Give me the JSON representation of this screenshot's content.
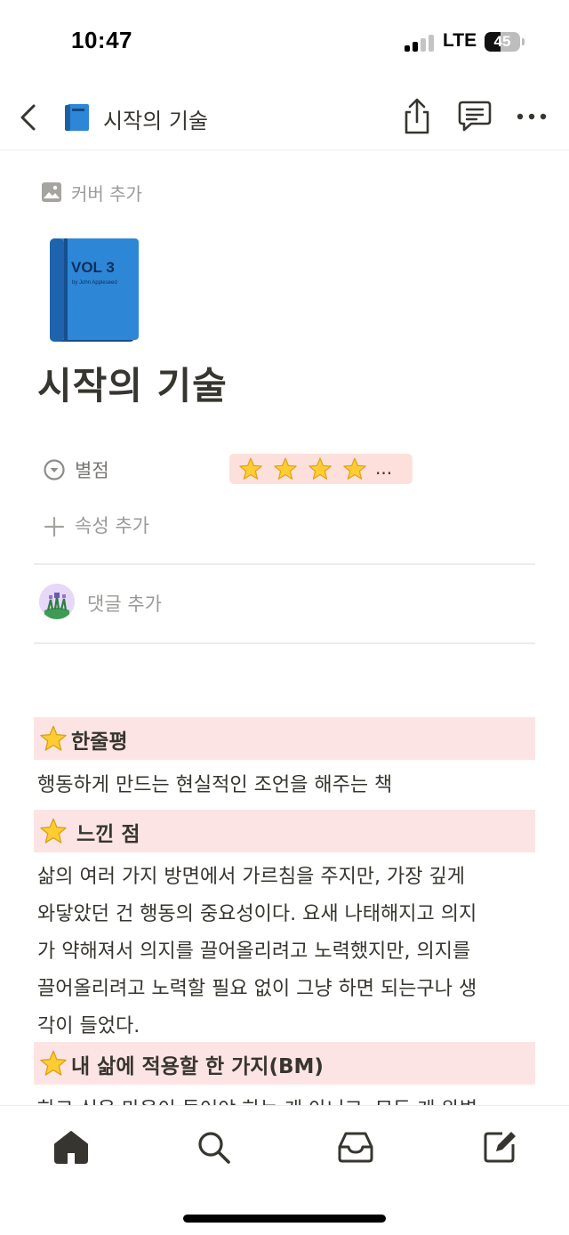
{
  "status_bar": {
    "time": "10:47",
    "network": "LTE",
    "battery": "45",
    "battery_level_percent": 45
  },
  "nav": {
    "title": "시작의 기술",
    "icons": [
      "back-chevron-icon",
      "book-icon",
      "share-icon",
      "comment-icon",
      "more-icon"
    ]
  },
  "page": {
    "add_cover": "커버 추가",
    "title": "시작의 기술",
    "icon": "blue-book-vol3-icon",
    "book_cover_text": {
      "vol": "VOL 3",
      "byline": "by John Appleseed"
    }
  },
  "properties": [
    {
      "name": "별점",
      "icon": "select-property-icon",
      "value_stars": 4,
      "overflow": "..."
    }
  ],
  "add_property": "속성 추가",
  "add_comment": "댓글 추가",
  "content": {
    "heading1": "한줄평",
    "text1": "행동하게 만드는 현실적인 조언을 해주는 책",
    "heading2": "느낀 점",
    "text2_lines": [
      "삶의 여러 가지 방면에서 가르침을 주지만, 가장 깊게",
      "와닿았던 건 행동의 중요성이다. 요새 나태해지고 의지",
      "가 약해져서 의지를 끌어올리려고 노력했지만, 의지를",
      "끌어올리려고 노력할 필요 없이 그냥 하면 되는구나 생",
      "각이 들었다."
    ],
    "heading3": "내 삶에 적용할 한 가지(BM)",
    "text3_partial": "하고 싶은 마음이 들어야 하는 게 아니고, 모든 게 완벽"
  },
  "bottom_tabs": [
    "home-icon",
    "search-icon",
    "inbox-icon",
    "new-page-icon"
  ],
  "colors": {
    "highlight_pink": "#fde4e4",
    "rating_bg": "#fde0dc",
    "text": "#37352f",
    "muted": "#9b9a97",
    "book_blue": "#2e86d6"
  }
}
